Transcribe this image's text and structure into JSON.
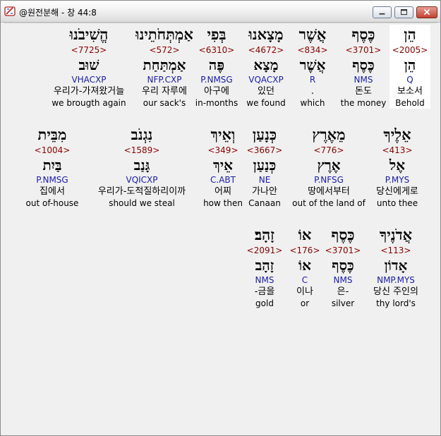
{
  "window": {
    "title": "@원전분해 - 창 44:8",
    "icon": "app-scroll-icon",
    "buttons": [
      "minimize",
      "maximize",
      "close"
    ]
  },
  "rows": [
    [
      {
        "hebrew": "הֵן",
        "strong": "<2005>",
        "lemma": "הֵן",
        "morph": "Q",
        "korean": "보소서",
        "english": "Behold",
        "highlight": true
      },
      {
        "hebrew": "כֶּסֶף",
        "strong": "<3701>",
        "lemma": "כֶּסֶף",
        "morph": "NMS",
        "korean": "돈도",
        "english": "the money"
      },
      {
        "hebrew": "אֲשֶׁר",
        "strong": "<834>",
        "lemma": "אֲשֶׁר",
        "morph": "R",
        "korean": ".",
        "english": "which"
      },
      {
        "hebrew": "מָצָאנוּ",
        "strong": "<4672>",
        "lemma": "מָצָא",
        "morph": "VQACXP",
        "korean": "있던",
        "english": "we found"
      },
      {
        "hebrew": "בְּפִי",
        "strong": "<6310>",
        "lemma": "פֶּה",
        "morph": "P.NMSG",
        "korean": "아구에",
        "english": "in-months"
      },
      {
        "hebrew": "אַמְתְּחֹתֵינוּ",
        "strong": "<572>",
        "lemma": "אַמְתַּחַת",
        "morph": "NFP.CXP",
        "korean": "우리 자루에",
        "english": "our sack's"
      },
      {
        "hebrew": "הֱשִׁיבֹנוּ",
        "strong": "<7725>",
        "lemma": "שׁוּב",
        "morph": "VHACXP",
        "korean": "우리가-가져왔거늘",
        "english": "we brougth again"
      }
    ],
    [
      {
        "hebrew": "אֵלֶיךָ",
        "strong": "<413>",
        "lemma": "אֶל",
        "morph": "P.MYS",
        "korean": "당신에게로",
        "english": "unto thee"
      },
      {
        "hebrew": "מֵאֶרֶץ",
        "strong": "<776>",
        "lemma": "אֶרֶץ",
        "morph": "P.NFSG",
        "korean": "땅에서부터",
        "english": "out of the land of"
      },
      {
        "hebrew": "כְּנָעַן",
        "strong": "<3667>",
        "lemma": "כְּנַעַן",
        "morph": "NE",
        "korean": "가나안",
        "english": "Canaan"
      },
      {
        "hebrew": "וְאֵיךְ",
        "strong": "<349>",
        "lemma": "אֵיךְ",
        "morph": "C.ABT",
        "korean": "어찌",
        "english": "how then"
      },
      {
        "hebrew": "נִגְנֹב",
        "strong": "<1589>",
        "lemma": "גָּנַב",
        "morph": "VQICXP",
        "korean": "우리가-도적질하리이까",
        "english": "should we steal"
      },
      {
        "hebrew": "מִבֵּית",
        "strong": "<1004>",
        "lemma": "בַּיִת",
        "morph": "P.NMSG",
        "korean": "집에서",
        "english": "out of-house"
      }
    ],
    [
      {
        "hebrew": "אֲדֹנֶיךָ",
        "strong": "<113>",
        "lemma": "אָדוֹן",
        "morph": "NMP.MYS",
        "korean": "당신 주인의",
        "english": "thy lord's"
      },
      {
        "hebrew": "כֶּסֶף",
        "strong": "<3701>",
        "lemma": "כֶּסֶף",
        "morph": "NMS",
        "korean": "은-",
        "english": "silver"
      },
      {
        "hebrew": "אוֹ",
        "strong": "<176>",
        "lemma": "אוֹ",
        "morph": "C",
        "korean": "이나",
        "english": "or"
      },
      {
        "hebrew": "זָהָב׃",
        "strong": "<2091>",
        "lemma": "זָהָב",
        "morph": "NMS",
        "korean": "-금을",
        "english": "gold"
      }
    ]
  ]
}
